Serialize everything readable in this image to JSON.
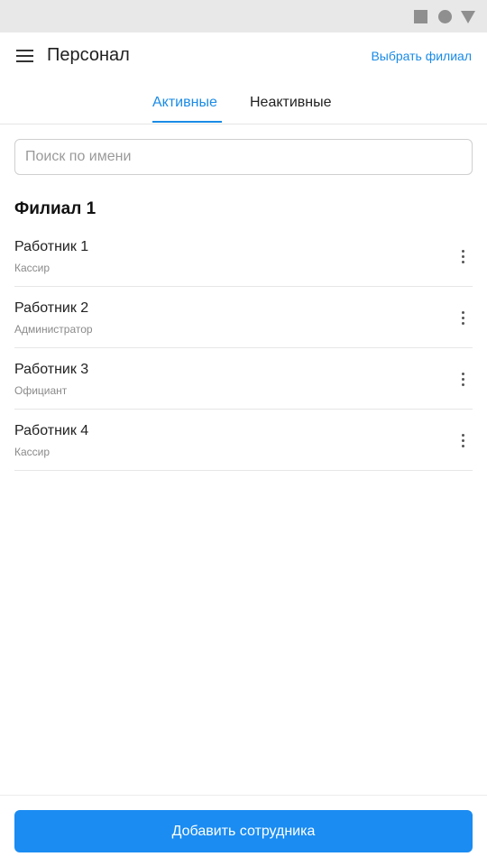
{
  "status_bar": {
    "icons": [
      "square-icon",
      "circle-icon",
      "triangle-icon"
    ],
    "color": "#8f8f8f"
  },
  "header": {
    "menu_icon": "menu-icon",
    "title": "Персонал",
    "action_label": "Выбрать филиал"
  },
  "tabs": [
    {
      "label": "Активные",
      "active": true
    },
    {
      "label": "Неактивные",
      "active": false
    }
  ],
  "search": {
    "value": "",
    "placeholder": "Поиск по имени"
  },
  "branch": {
    "title": "Филиал 1",
    "employees": [
      {
        "name": "Работник 1",
        "role": "Кассир"
      },
      {
        "name": "Работник 2",
        "role": "Администратор"
      },
      {
        "name": "Работник 3",
        "role": "Официант"
      },
      {
        "name": "Работник 4",
        "role": "Кассир"
      }
    ]
  },
  "footer": {
    "add_label": "Добавить сотрудника"
  },
  "colors": {
    "accent": "#1a8be6",
    "button": "#1a8cf2"
  }
}
